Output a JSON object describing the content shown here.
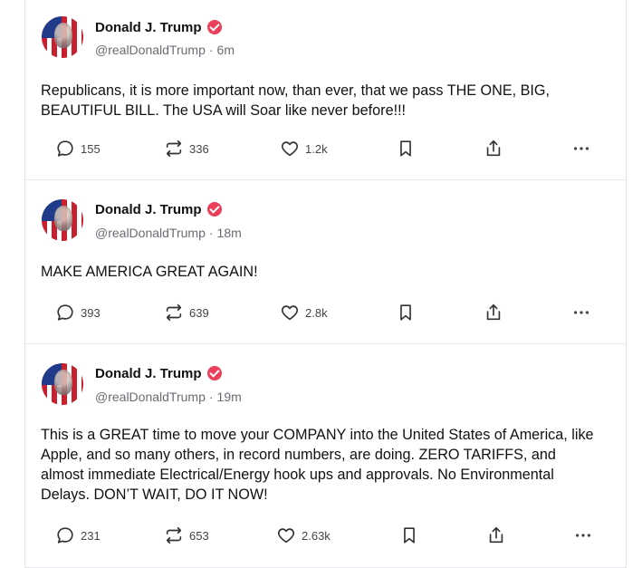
{
  "posts": [
    {
      "author": "Donald J. Trump",
      "handle": "@realDonaldTrump",
      "separator": "·",
      "time": "6m",
      "text": "Republicans, it is more important now, than ever, that we pass THE ONE, BIG, BEAUTIFUL BILL. The USA will Soar like never before!!!",
      "replies": "155",
      "reposts": "336",
      "likes": "1.2k"
    },
    {
      "author": "Donald J. Trump",
      "handle": "@realDonaldTrump",
      "separator": "·",
      "time": "18m",
      "text": "MAKE AMERICA GREAT AGAIN!",
      "replies": "393",
      "reposts": "639",
      "likes": "2.8k"
    },
    {
      "author": "Donald J. Trump",
      "handle": "@realDonaldTrump",
      "separator": "·",
      "time": "19m",
      "text": "This is a GREAT time to move your COMPANY into the United States of America, like Apple, and so many others, in record numbers, are doing. ZERO TARIFFS, and almost immediate Electrical/Energy hook ups and approvals. No Environmental Delays. DON’T WAIT, DO IT NOW!",
      "replies": "231",
      "reposts": "653",
      "likes": "2.63k"
    }
  ],
  "icons": {
    "verified": "verified-badge-icon",
    "reply": "comment-icon",
    "repost": "repost-icon",
    "like": "heart-icon",
    "bookmark": "bookmark-icon",
    "share": "share-icon",
    "more": "more-options-icon"
  },
  "colors": {
    "verified_badge": "#ec3f5c",
    "muted_text": "#6b6b75",
    "divider": "#e8e8ec"
  }
}
